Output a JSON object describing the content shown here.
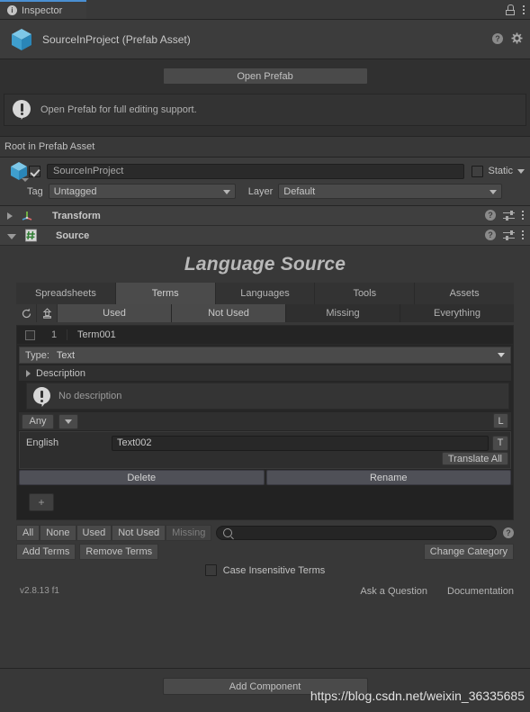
{
  "window": {
    "tab_label": "Inspector",
    "tab_icon": "info-icon",
    "lock_icon": "lock-icon",
    "menu_icon": "kebab-menu-icon"
  },
  "asset_header": {
    "title": "SourceInProject (Prefab Asset)",
    "icon": "prefab-cube-icon",
    "help_icon": "help-icon",
    "settings_icon": "gear-icon"
  },
  "prefab_panel": {
    "open_prefab_label": "Open Prefab",
    "help_message": "Open Prefab for full editing support.",
    "warning_icon": "info-bubble-icon"
  },
  "root_bar": {
    "label": "Root in Prefab Asset"
  },
  "gameobject": {
    "enabled": true,
    "name": "SourceInProject",
    "static_label": "Static",
    "tag_label": "Tag",
    "tag_value": "Untagged",
    "layer_label": "Layer",
    "layer_value": "Default",
    "icon": "prefab-cube-icon"
  },
  "components": [
    {
      "name": "Transform",
      "icon": "transform-axis-icon",
      "expanded": false
    },
    {
      "name": "Source",
      "icon": "script-hash-icon",
      "expanded": true
    }
  ],
  "language_source": {
    "title": "Language Source",
    "tabs": [
      {
        "label": "Spreadsheets",
        "active": false
      },
      {
        "label": "Terms",
        "active": true
      },
      {
        "label": "Languages",
        "active": false
      },
      {
        "label": "Tools",
        "active": false
      },
      {
        "label": "Assets",
        "active": false
      }
    ],
    "filters": {
      "refresh_icon": "refresh-icon",
      "export_icon": "upload-icon",
      "buttons": [
        {
          "label": "Used",
          "selected": true
        },
        {
          "label": "Not Used",
          "selected": true
        },
        {
          "label": "Missing",
          "selected": false
        },
        {
          "label": "Everything",
          "selected": false
        }
      ]
    },
    "term": {
      "checked": false,
      "index": "1",
      "name": "Term001",
      "type_label": "Type:",
      "type_value": "Text",
      "description_label": "Description",
      "no_description_text": "No description",
      "any_label": "Any",
      "language_button_label": "L",
      "translation_button_label": "T",
      "translate_all_label": "Translate All",
      "languages": [
        {
          "name": "English",
          "value": "Text002"
        }
      ],
      "delete_label": "Delete",
      "rename_label": "Rename",
      "add_label": "+"
    },
    "bottom": {
      "select_buttons": [
        {
          "label": "All",
          "dim": false
        },
        {
          "label": "None",
          "dim": false
        },
        {
          "label": "Used",
          "dim": false
        },
        {
          "label": "Not Used",
          "dim": false
        },
        {
          "label": "Missing",
          "dim": true
        }
      ],
      "search_placeholder": "",
      "search_icon": "search-icon",
      "help_icon": "help-icon",
      "add_terms_label": "Add Terms",
      "remove_terms_label": "Remove Terms",
      "change_category_label": "Change Category",
      "case_insensitive_label": "Case Insensitive Terms",
      "case_insensitive_checked": false,
      "version": "v2.8.13 f1",
      "ask_question_label": "Ask a Question",
      "documentation_label": "Documentation"
    }
  },
  "footer": {
    "add_component_label": "Add Component",
    "watermark": "https://blog.csdn.net/weixin_36335685"
  },
  "colors": {
    "accent": "#4a8fd2",
    "panel": "#383838",
    "header": "#3c3c3c",
    "button": "#4a4a4a"
  }
}
